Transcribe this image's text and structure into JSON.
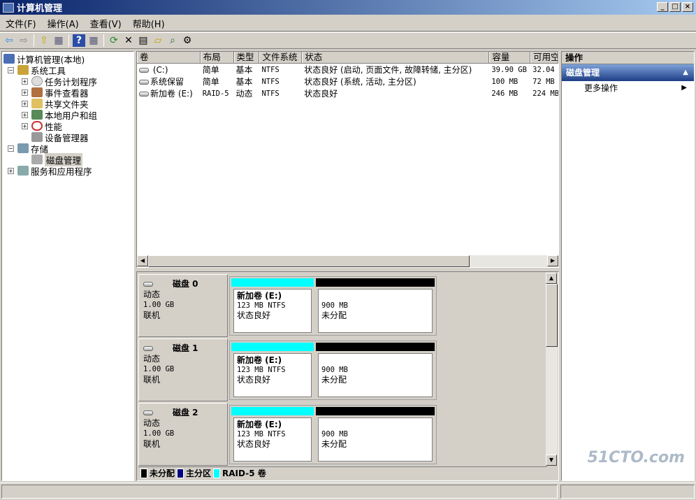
{
  "window": {
    "title": "计算机管理"
  },
  "menu": [
    "文件(F)",
    "操作(A)",
    "查看(V)",
    "帮助(H)"
  ],
  "tree": {
    "root": "计算机管理(本地)",
    "system_tools": "系统工具",
    "system_children": [
      "任务计划程序",
      "事件查看器",
      "共享文件夹",
      "本地用户和组",
      "性能",
      "设备管理器"
    ],
    "storage": "存储",
    "disk_mgmt": "磁盘管理",
    "services": "服务和应用程序"
  },
  "volumes": {
    "columns": [
      "卷",
      "布局",
      "类型",
      "文件系统",
      "状态",
      "容量",
      "可用空"
    ],
    "rows": [
      {
        "vol": " (C:)",
        "layout": "简单",
        "type": "基本",
        "fs": "NTFS",
        "status": "状态良好 (启动, 页面文件, 故障转储, 主分区)",
        "cap": "39.90 GB",
        "free": "32.04"
      },
      {
        "vol": "系统保留",
        "layout": "简单",
        "type": "基本",
        "fs": "NTFS",
        "status": "状态良好 (系统, 活动, 主分区)",
        "cap": "100 MB",
        "free": "72 MB"
      },
      {
        "vol": "新加卷 (E:)",
        "layout": "RAID-5",
        "type": "动态",
        "fs": "NTFS",
        "status": "状态良好",
        "cap": "246 MB",
        "free": "224 MB"
      }
    ]
  },
  "disks": [
    {
      "name": "磁盘 0",
      "type": "动态",
      "size": "1.00 GB",
      "state": "联机",
      "vol_name": "新加卷  (E:)",
      "vol_info": "123 MB NTFS",
      "vol_status": "状态良好",
      "unalloc_size": "900 MB",
      "unalloc_label": "未分配"
    },
    {
      "name": "磁盘 1",
      "type": "动态",
      "size": "1.00 GB",
      "state": "联机",
      "vol_name": "新加卷  (E:)",
      "vol_info": "123 MB NTFS",
      "vol_status": "状态良好",
      "unalloc_size": "900 MB",
      "unalloc_label": "未分配"
    },
    {
      "name": "磁盘 2",
      "type": "动态",
      "size": "1.00 GB",
      "state": "联机",
      "vol_name": "新加卷  (E:)",
      "vol_info": "123 MB NTFS",
      "vol_status": "状态良好",
      "unalloc_size": "900 MB",
      "unalloc_label": "未分配"
    }
  ],
  "legend": [
    {
      "label": "未分配",
      "color": "#000000"
    },
    {
      "label": "主分区",
      "color": "#000080"
    },
    {
      "label": "RAID-5 卷",
      "color": "#00ffff"
    }
  ],
  "actions": {
    "header": "操作",
    "section": "磁盘管理",
    "more": "更多操作"
  },
  "watermark": "51CTO.com"
}
